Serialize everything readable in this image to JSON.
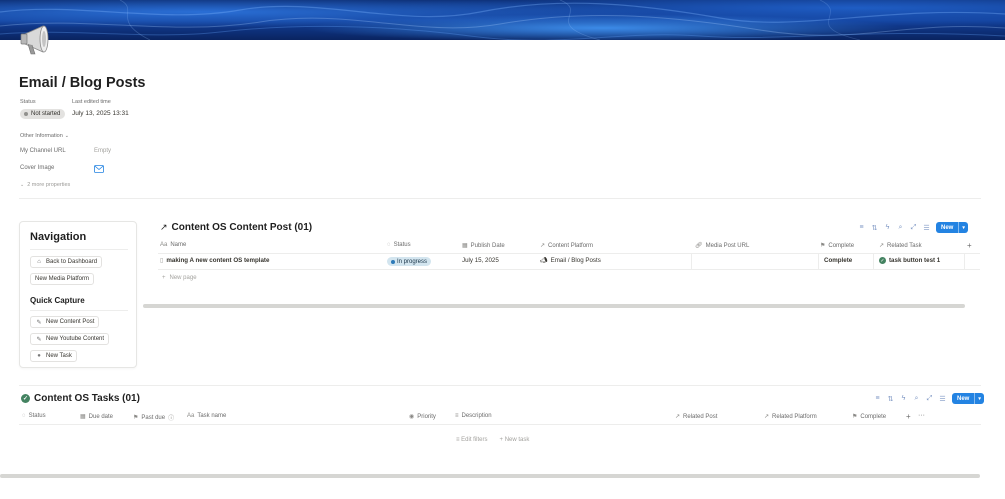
{
  "page": {
    "title": "Email / Blog Posts",
    "icon": "megaphone-icon"
  },
  "properties": {
    "status_label": "Status",
    "status_value": "Not started",
    "edited_label": "Last edited time",
    "edited_value": "July 13, 2025 13:31",
    "other_info": "Other Information",
    "channel_url_label": "My Channel URL",
    "channel_url_value": "Empty",
    "cover_image_label": "Cover Image",
    "more_properties": "2 more properties"
  },
  "navigation": {
    "title": "Navigation",
    "buttons": [
      "Back to Dashboard",
      "New Media Platform"
    ],
    "quick_capture_title": "Quick Capture",
    "quick_buttons": [
      "New Content Post",
      "New Youtube Content",
      "New Task"
    ]
  },
  "content_db": {
    "title": "Content OS Content Post (01)",
    "new_label": "New",
    "columns": [
      "Name",
      "Status",
      "Publish Date",
      "Content Platform",
      "Media Post URL",
      "Complete",
      "Related Task"
    ],
    "row": {
      "name": "making A new content OS template",
      "status": "In progress",
      "publish_date": "July 15, 2025",
      "platform": "Email / Blog Posts",
      "media_url": "",
      "complete": "Complete",
      "related_task": "task button test 1"
    },
    "new_page": "New page",
    "add_column": "+"
  },
  "tasks_db": {
    "title": "Content OS Tasks (01)",
    "new_label": "New",
    "columns": [
      "Status",
      "Due date",
      "Past due",
      "Task name",
      "Priority",
      "Description",
      "Related Post",
      "Related Platform",
      "Complete"
    ],
    "add_column": "+",
    "more": "···",
    "edit_filters": "Edit filters",
    "new_task": "New task"
  },
  "colors": {
    "accent": "#2383e2",
    "status_gray": "#e3e2e0",
    "in_progress_bg": "#d3e5ef",
    "complete_green": "#448361"
  }
}
